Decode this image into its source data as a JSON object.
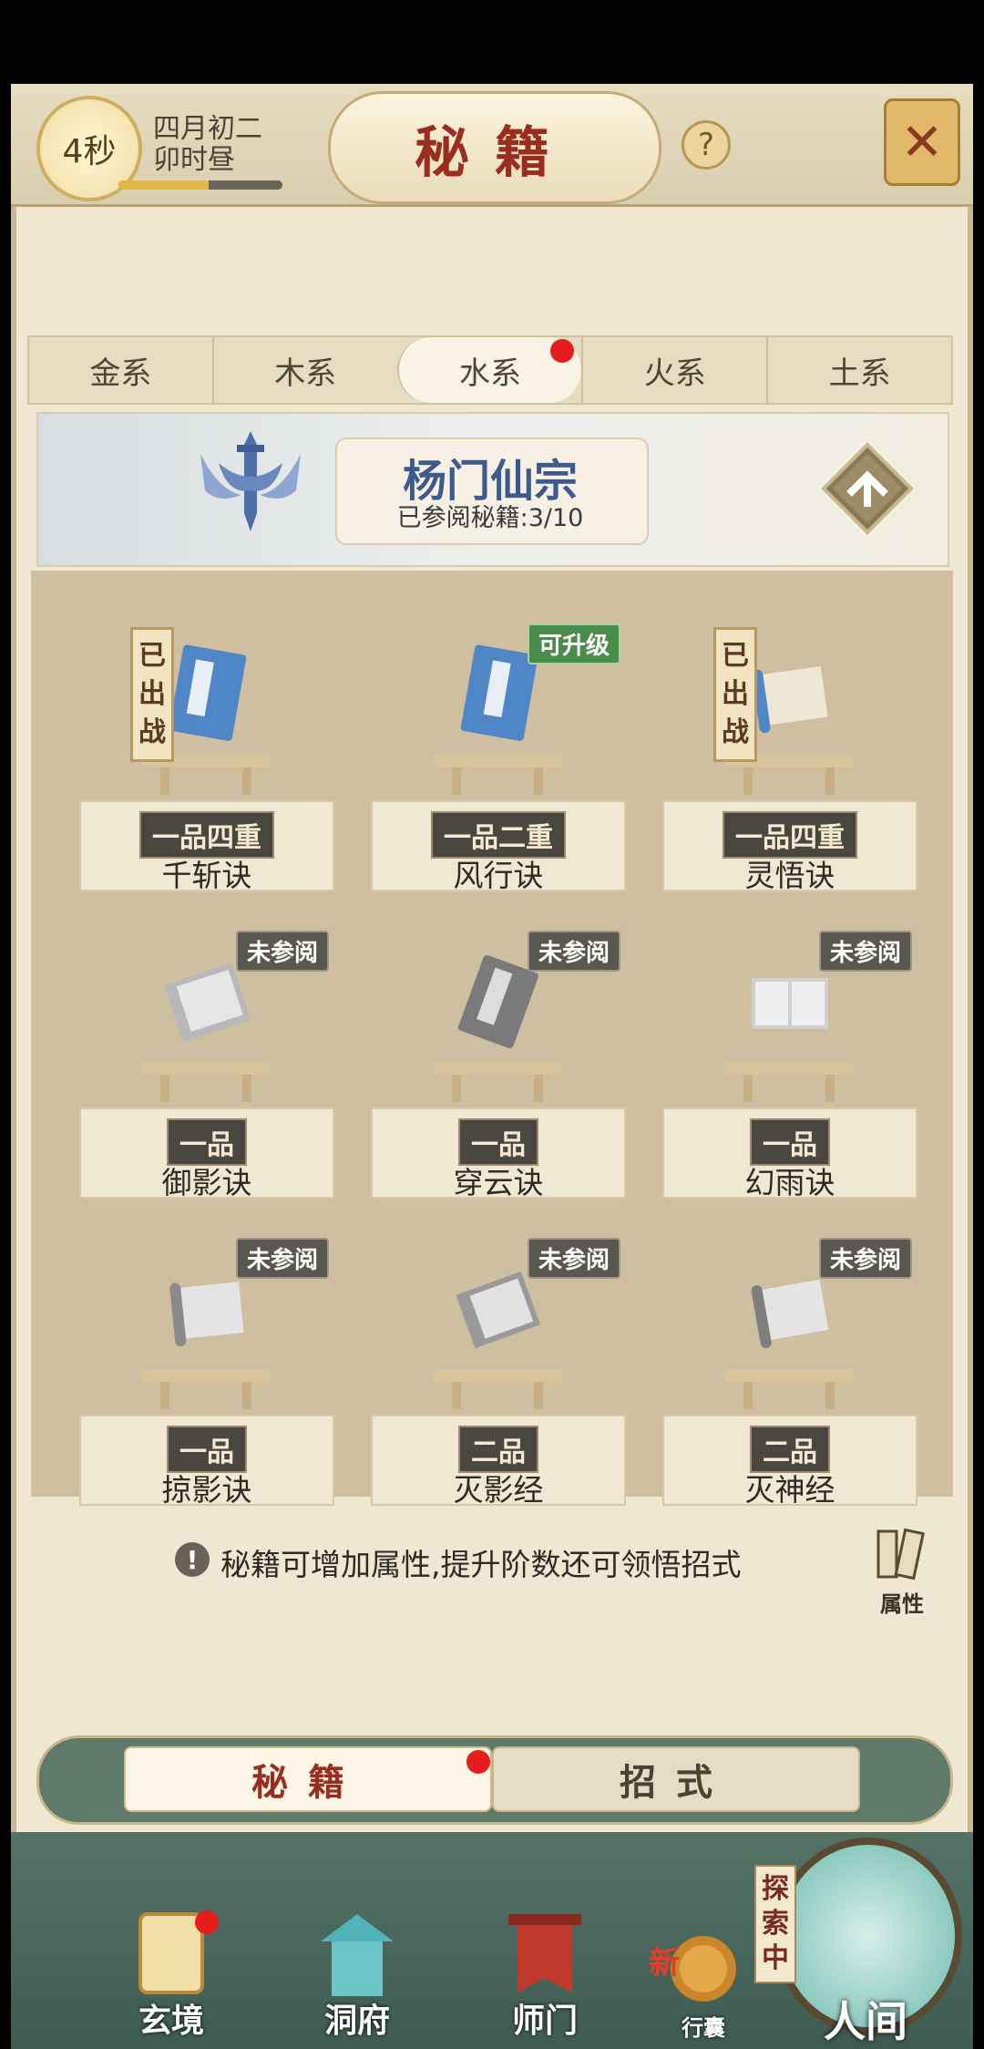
{
  "header": {
    "timer": "4秒",
    "date_line1": "四月初二",
    "date_line2": "卯时昼",
    "progress": 0.55,
    "title": "秘籍",
    "help_label": "?"
  },
  "elements_tabs": [
    {
      "label": "金系"
    },
    {
      "label": "木系"
    },
    {
      "label": "水系",
      "active": true,
      "dot": true
    },
    {
      "label": "火系"
    },
    {
      "label": "土系"
    }
  ],
  "sect": {
    "name": "杨门仙宗",
    "read_label": "已参阅秘籍:3/10"
  },
  "books": [
    {
      "rank": "一品四重",
      "name": "千斩诀",
      "status": "已出战",
      "kind": "blue-book"
    },
    {
      "rank": "一品二重",
      "name": "风行诀",
      "badge": "可升级",
      "kind": "blue-book"
    },
    {
      "rank": "一品四重",
      "name": "灵悟诀",
      "status": "已出战",
      "kind": "scroll"
    },
    {
      "rank": "一品",
      "name": "御影诀",
      "badge": "未参阅",
      "kind": "grey-book"
    },
    {
      "rank": "一品",
      "name": "穿云诀",
      "badge": "未参阅",
      "kind": "grey-book"
    },
    {
      "rank": "一品",
      "name": "幻雨诀",
      "badge": "未参阅",
      "kind": "grey-book"
    },
    {
      "rank": "一品",
      "name": "掠影诀",
      "badge": "未参阅",
      "kind": "grey-scroll"
    },
    {
      "rank": "二品",
      "name": "灭影经",
      "badge": "未参阅",
      "kind": "grey-book"
    },
    {
      "rank": "二品",
      "name": "灭神经",
      "badge": "未参阅",
      "kind": "grey-scroll"
    }
  ],
  "tip": {
    "icon": "!",
    "text": "秘籍可增加属性,提升阶数还可领悟招式",
    "attr_label": "属性"
  },
  "switch": {
    "left": "秘籍",
    "right": "招式"
  },
  "nav": {
    "items": [
      {
        "label": "玄境"
      },
      {
        "label": "洞府"
      },
      {
        "label": "师门"
      },
      {
        "label": "新"
      },
      {
        "label": "行囊"
      }
    ],
    "explore": "探索中",
    "world": "人间"
  },
  "colors": {
    "accent_red": "#9a2d1f",
    "notify_red": "#e51d1d",
    "badge_green": "#4b8c4b",
    "badge_grey": "#5a5650"
  }
}
